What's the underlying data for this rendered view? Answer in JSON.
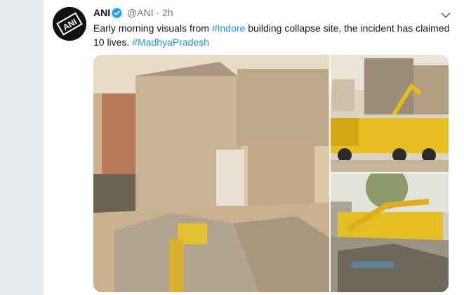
{
  "tweet": {
    "author_name": "ANI",
    "verified_icon": "verified-badge-icon",
    "handle": "@ANI",
    "separator": "·",
    "time": "2h",
    "text_parts": [
      "Early morning visuals from ",
      "#Indore",
      " building collapse site, the incident has claimed 10 lives. ",
      "#MadhyaPradesh"
    ],
    "menu_icon": "chevron-down-icon",
    "avatar_text": "ANI"
  },
  "colors": {
    "link": "#1b95e0",
    "verified": "#1da1f2",
    "muted": "#657786",
    "text": "#14171a",
    "background": "#e6ecf0"
  }
}
